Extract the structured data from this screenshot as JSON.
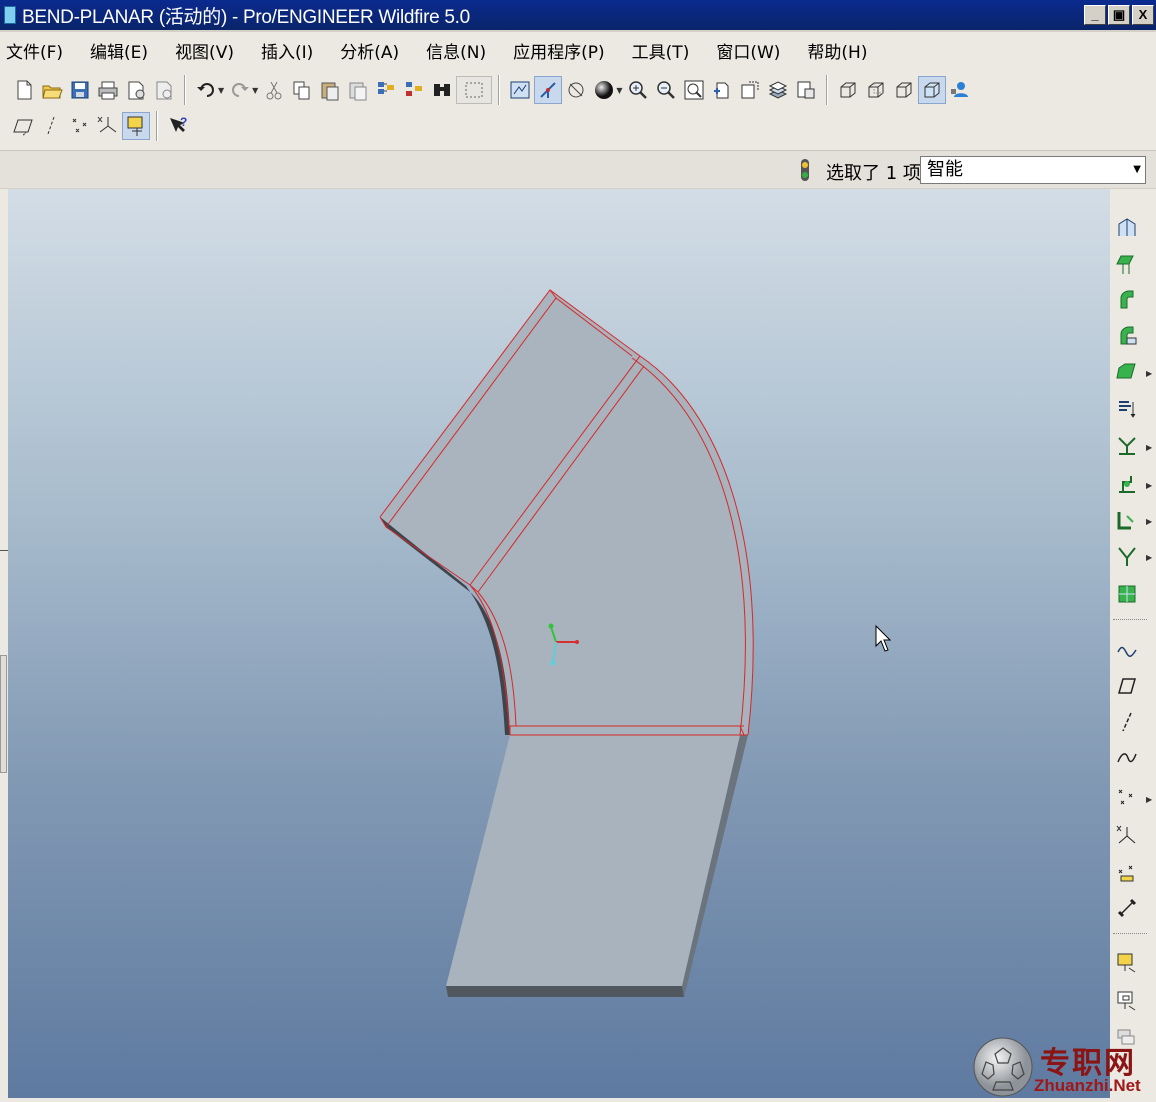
{
  "window": {
    "title": "BEND-PLANAR (活动的) - Pro/ENGINEER Wildfire 5.0",
    "buttons": {
      "minimize": "_",
      "maximize": "▣",
      "close": "X"
    }
  },
  "menubar": {
    "items": [
      {
        "label": "文件(F)"
      },
      {
        "label": "编辑(E)"
      },
      {
        "label": "视图(V)"
      },
      {
        "label": "插入(I)"
      },
      {
        "label": "分析(A)"
      },
      {
        "label": "信息(N)"
      },
      {
        "label": "应用程序(P)"
      },
      {
        "label": "工具(T)"
      },
      {
        "label": "窗口(W)"
      },
      {
        "label": "帮助(H)"
      }
    ]
  },
  "toolbar": {
    "row1": [
      "new-icon",
      "open-icon",
      "save-icon",
      "print-icon",
      "send-mail-icon",
      "send-link-icon",
      "undo-icon",
      "redo-icon",
      "cut-icon",
      "copy-icon",
      "paste-icon",
      "paste-special-icon",
      "regenerate-icon",
      "regen-manager-icon",
      "find-icon",
      "select-box-icon",
      "repaint-icon",
      "spin-center-icon",
      "orient-mode-icon",
      "appearance-icon",
      "zoom-in-icon",
      "zoom-out-icon",
      "refit-icon",
      "reorient-icon",
      "saved-views-icon",
      "layers-icon",
      "view-manager-icon",
      "wireframe-icon",
      "hidden-line-icon",
      "no-hidden-icon",
      "shading-icon",
      "model-tree-icon"
    ],
    "row2": [
      "datum-planes-icon",
      "datum-axes-icon",
      "datum-points-icon",
      "coordinate-systems-icon",
      "annotation-display-icon",
      "context-help-icon"
    ]
  },
  "status": {
    "selection_count": "选取了 1 项",
    "filter_value": "智能"
  },
  "righttools": [
    "sheetmetal-wall-icon",
    "flat-wall-icon",
    "flange-wall-icon",
    "unattached-wall-icon",
    "extrude-cut-icon",
    "rip-icon",
    "merge-walls-icon",
    "convert-icon",
    "bend-icon",
    "unbend-icon",
    "flat-pattern-icon",
    "sketch-icon",
    "datum-plane-icon",
    "datum-axis-icon",
    "datum-curve-icon",
    "datum-point-icon",
    "datum-csys-icon",
    "analysis-feature-icon",
    "insert-feature-icon",
    "form-icon",
    "punch-icon",
    "die-icon"
  ],
  "watermark": {
    "cn": "专职网",
    "en": "Zhuanzhi.Net"
  },
  "colors": {
    "part_face": "#a8b3bd",
    "part_edge_highlight": "#d62828",
    "part_side": "#565d66",
    "csys_y": "#31c43a",
    "csys_x": "#d83030",
    "csys_z": "#5ad0d8"
  }
}
